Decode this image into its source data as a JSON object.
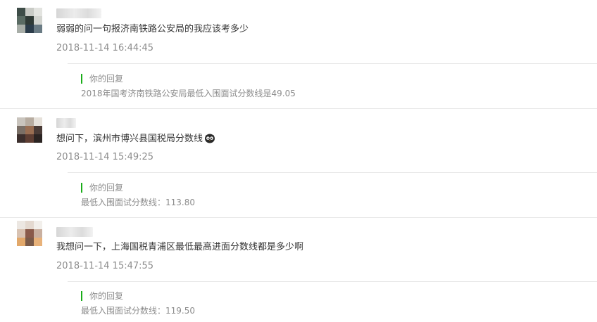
{
  "reply_label": "你的回复",
  "comments": [
    {
      "content": "弱弱的问一句报济南铁路公安局的我应该考多少",
      "time": "2018-11-14 16:44:45",
      "reply": "2018年国考济南铁路公安局最低入围面试分数线是49.05",
      "avatar_colors": [
        "#3e4d48",
        "#c9cbc6",
        "#e3e4e0",
        "#5a6b63",
        "#2f3a36",
        "#d2d4cf",
        "#a8aea8",
        "#2b3c4a",
        "#6a7b84"
      ]
    },
    {
      "content": "想问下，滨州市博兴县国税局分数线",
      "emoji": "owl-emoji-icon",
      "time": "2018-11-14 15:49:25",
      "reply": "最低入围面试分数线：113.80",
      "avatar_colors": [
        "#c9c4bd",
        "#b7aca0",
        "#e6e1da",
        "#7a6f66",
        "#9a6e52",
        "#4a3b36",
        "#3c2f2d",
        "#5e3e33",
        "#2b2422"
      ]
    },
    {
      "content": "我想问一下，上海国税青浦区最低最高进面分数线都是多少啊",
      "time": "2018-11-14 15:47:55",
      "reply": "最低入围面试分数线：119.50",
      "avatar_colors": [
        "#ece7e2",
        "#e4d9d0",
        "#f2efeb",
        "#d8c2b2",
        "#8a5a4a",
        "#c9b0a0",
        "#e2a86a",
        "#7a5a48",
        "#e8b27a"
      ]
    }
  ]
}
